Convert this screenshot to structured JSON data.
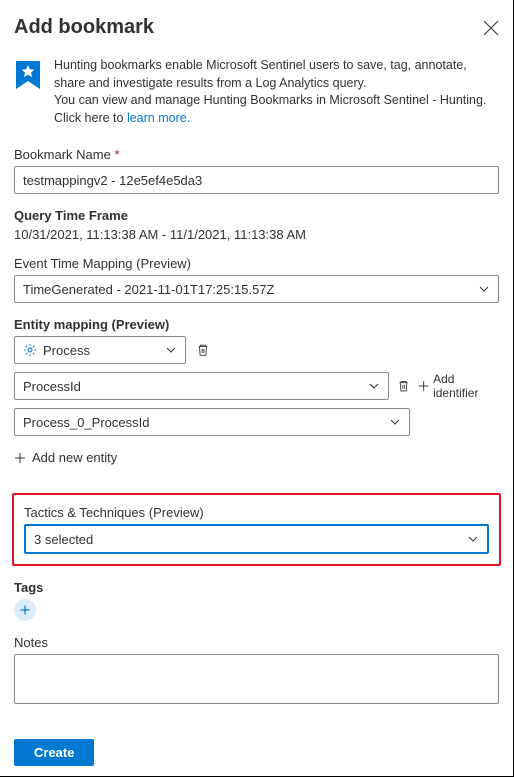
{
  "header": {
    "title": "Add bookmark"
  },
  "info": {
    "line1": "Hunting bookmarks enable Microsoft Sentinel users to save, tag, annotate, share and investigate results from a Log Analytics query.",
    "line2": "You can view and manage Hunting Bookmarks in Microsoft Sentinel - Hunting.",
    "line3_prefix": "Click here to ",
    "learn_more": "learn more."
  },
  "bookmark_name": {
    "label": "Bookmark Name",
    "value": "testmappingv2 - 12e5ef4e5da3"
  },
  "query_time": {
    "label": "Query Time Frame",
    "value": "10/31/2021, 11:13:38 AM - 11/1/2021, 11:13:38 AM"
  },
  "event_time": {
    "label": "Event Time Mapping (Preview)",
    "value": "TimeGenerated - 2021-11-01T17:25:15.57Z"
  },
  "entity_mapping": {
    "label": "Entity mapping (Preview)",
    "entity_type": "Process",
    "identifier": "ProcessId",
    "value_field": "Process_0_ProcessId",
    "add_identifier": "Add identifier",
    "add_entity": "Add new entity"
  },
  "tactics": {
    "label": "Tactics & Techniques (Preview)",
    "value": "3 selected"
  },
  "tags": {
    "label": "Tags"
  },
  "notes": {
    "label": "Notes"
  },
  "footer": {
    "create": "Create"
  }
}
